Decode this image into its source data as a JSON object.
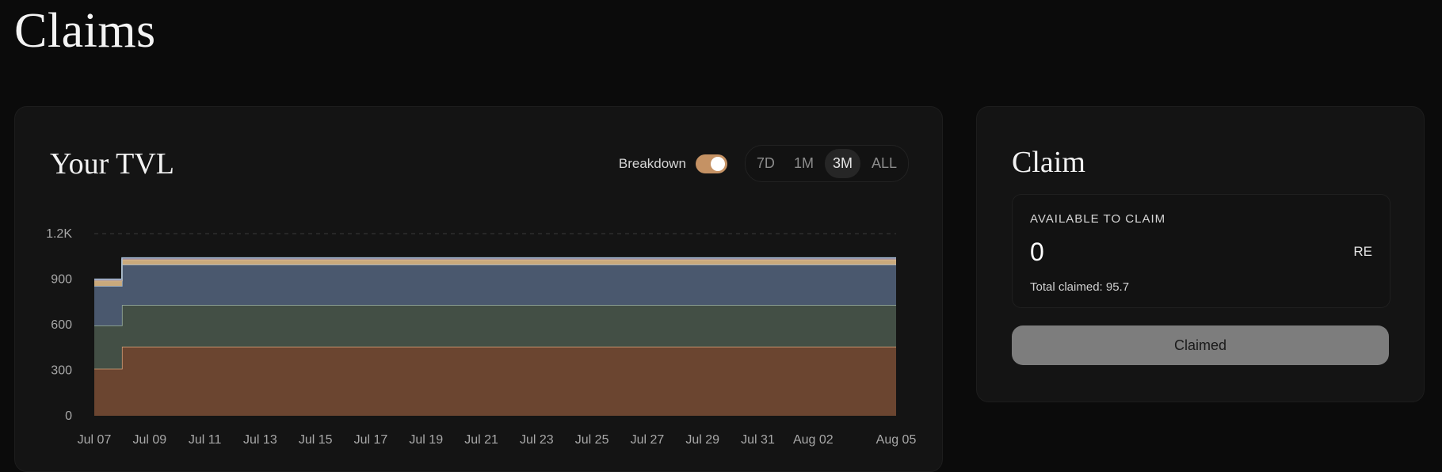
{
  "page": {
    "title": "Claims"
  },
  "tvl_panel": {
    "title": "Your TVL",
    "breakdown_label": "Breakdown",
    "breakdown_on": true,
    "ranges": [
      {
        "label": "7D",
        "active": false
      },
      {
        "label": "1M",
        "active": false
      },
      {
        "label": "3M",
        "active": true
      },
      {
        "label": "ALL",
        "active": false
      }
    ]
  },
  "claim_panel": {
    "title": "Claim",
    "available_label": "AVAILABLE TO CLAIM",
    "available_amount": "0",
    "unit": "RE",
    "total_claimed": "Total claimed: 95.7",
    "button_label": "Claimed"
  },
  "chart_data": {
    "type": "area",
    "stacked": true,
    "grid": true,
    "y_ticks": [
      "0",
      "300",
      "600",
      "900",
      "1.2K"
    ],
    "y_tick_values": [
      0,
      300,
      600,
      900,
      1200
    ],
    "ylim": [
      0,
      1200
    ],
    "x_ticks": [
      "Jul 07",
      "Jul 09",
      "Jul 11",
      "Jul 13",
      "Jul 15",
      "Jul 17",
      "Jul 19",
      "Jul 21",
      "Jul 23",
      "Jul 25",
      "Jul 27",
      "Jul 29",
      "Jul 31",
      "Aug 02",
      "Aug 05"
    ],
    "x_tick_days": [
      0,
      2,
      4,
      6,
      8,
      10,
      12,
      14,
      16,
      18,
      20,
      22,
      24,
      26,
      29
    ],
    "x_days": [
      0,
      1,
      29
    ],
    "series": [
      {
        "color": "#6b4530",
        "line": "#d9a27a",
        "values": [
          310,
          455,
          455
        ]
      },
      {
        "color": "#434f45",
        "line": "#9fb5a5",
        "values": [
          285,
          275,
          275
        ]
      },
      {
        "color": "#4a586e",
        "line": "#9db3cc",
        "values": [
          260,
          265,
          265
        ]
      },
      {
        "color": "#c9a97c",
        "line": "#e6c79a",
        "values": [
          35,
          35,
          35
        ]
      },
      {
        "color": "#8a7a92",
        "line": "#a9c1d9",
        "values": [
          10,
          10,
          10
        ]
      }
    ]
  }
}
